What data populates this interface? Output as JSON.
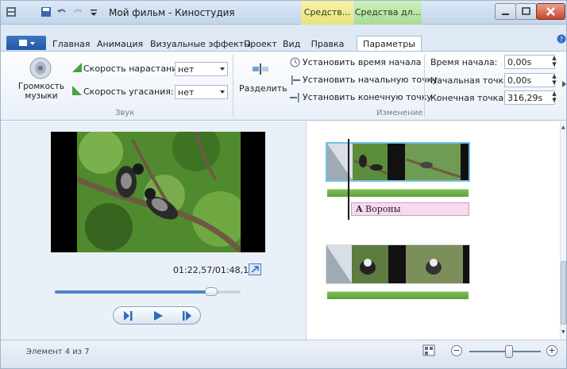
{
  "window": {
    "title": "Мой фильм - Киностудия"
  },
  "context_tabs": {
    "tab1": "Средств...",
    "tab2": "Средства дл..."
  },
  "ribbon_tabs": {
    "file": "",
    "items": [
      "Главная",
      "Анимация",
      "Визуальные эффекты",
      "Проект",
      "Вид",
      "Правка",
      "Параметры"
    ],
    "active": "Параметры"
  },
  "ribbon": {
    "audio_group": {
      "label": "Звук",
      "music_volume": "Громкость музыки",
      "fade_in_label": "Скорость нарастания:",
      "fade_in_value": "нет",
      "fade_out_label": "Скорость угасания:",
      "fade_out_value": "нет"
    },
    "edit_group": {
      "label": "Изменение",
      "split": "Разделить",
      "set_start_time": "Установить время начала",
      "set_start_point": "Установить начальную точку",
      "set_end_point": "Установить конечную точку",
      "start_time_label": "Время начала:",
      "start_time_value": "0,00s",
      "start_point_label": "Начальная точка:",
      "start_point_value": "0,00s",
      "end_point_label": "Конечная точка:",
      "end_point_value": "316,29s"
    }
  },
  "preview": {
    "time": "01:22,57/01:48,18",
    "seek_fraction": 0.84
  },
  "storyboard": {
    "caption": "Вороны"
  },
  "status": {
    "text": "Элемент 4 из 7",
    "zoom_fraction": 0.55
  },
  "colors": {
    "accent": "#2b6cc0",
    "audio": "#5fa23a",
    "caption_bg": "#f7d9f0"
  }
}
